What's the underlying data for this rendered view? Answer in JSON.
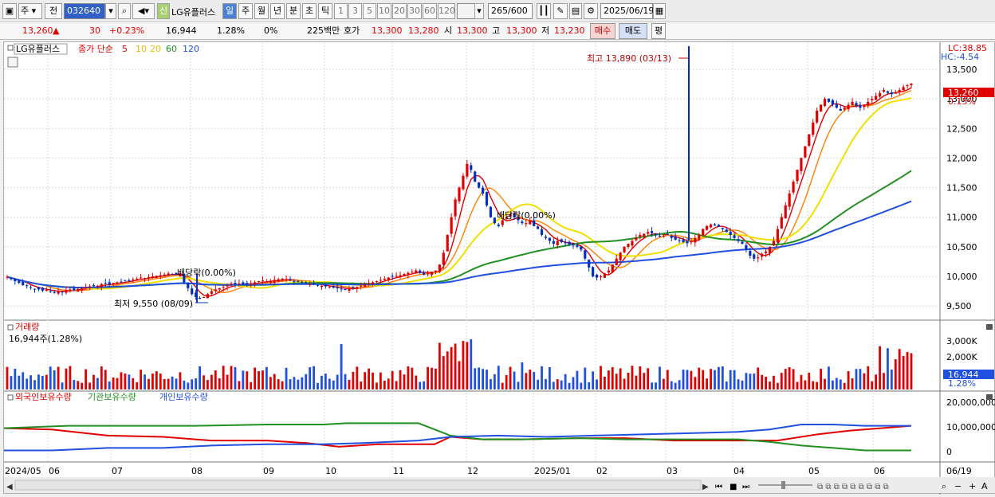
{
  "toolbar": {
    "type_sel": "주",
    "prev_sel": "전",
    "code": "032640",
    "new_badge": "신",
    "name": "LG유플러스",
    "periods": [
      "일",
      "주",
      "월",
      "년",
      "분",
      "초",
      "틱"
    ],
    "active_period": "일",
    "intervals": [
      "1",
      "3",
      "5",
      "10",
      "20",
      "30",
      "60",
      "120"
    ],
    "count": "265",
    "count_max": "/600",
    "date": "2025/06/19"
  },
  "quote": {
    "price": "13,260",
    "arrow": "▲",
    "change": "30",
    "pct": "+0.23%",
    "volume": "16,944",
    "turnover": "1.28%",
    "zero_pct": "0%",
    "amount": "225백만",
    "ask_label": "호가",
    "ask": "13,300",
    "bid": "13,280",
    "open_label": "시",
    "open": "13,300",
    "high_label": "고",
    "high": "13,300",
    "low_label": "저",
    "low": "13,230",
    "buy_btn": "매수",
    "sell_btn": "매도",
    "eval_btn": "평"
  },
  "chart_data": [
    {
      "type": "candlestick",
      "title": "LG유플러스",
      "legend": {
        "main": "종가 단순",
        "ma": [
          {
            "name": "5",
            "color": "#e00000"
          },
          {
            "name": "10",
            "color": "#ff8000"
          },
          {
            "name": "20",
            "color": "#e8e800"
          },
          {
            "name": "60",
            "color": "#209020"
          },
          {
            "name": "120",
            "color": "#2050e0"
          }
        ]
      },
      "y_ticks": [
        "13,500",
        "13,000",
        "12,500",
        "12,000",
        "11,500",
        "11,000",
        "10,500",
        "10,000",
        "9,500"
      ],
      "ylim": [
        9300,
        13850
      ],
      "x_labels": [
        "2024/05",
        "06",
        "07",
        "08",
        "09",
        "10",
        "11",
        "12",
        "2025/01",
        "02",
        "03",
        "04",
        "05",
        "06"
      ],
      "current_price_tag": "13,260",
      "current_pct_tag": "0.15%",
      "lc": "LC:38.85",
      "hc": "HC:-4.54",
      "bottom_date": "06/19",
      "annotations": {
        "high": "최고 13,890 (03/13)",
        "low": "최저 9,550 (08/09)",
        "div1": "배당락(0.00%)",
        "div2": "배당락(0.00%)"
      },
      "close_series": [
        9990,
        9960,
        9920,
        9890,
        9850,
        9840,
        9810,
        9790,
        9780,
        9760,
        9770,
        9750,
        9730,
        9750,
        9740,
        9770,
        9780,
        9760,
        9790,
        9800,
        9810,
        9830,
        9850,
        9840,
        9870,
        9880,
        9860,
        9890,
        9900,
        9910,
        9930,
        9920,
        9950,
        9960,
        9980,
        9970,
        9990,
        10000,
        10010,
        10020,
        10030,
        10050,
        10040,
        10030,
        10050,
        9900,
        9800,
        9700,
        9650,
        9620,
        9650,
        9700,
        9750,
        9780,
        9800,
        9820,
        9850,
        9880,
        9870,
        9880,
        9860,
        9870,
        9880,
        9900,
        9920,
        9930,
        9910,
        9920,
        9940,
        9950,
        9960,
        9950,
        9930,
        9920,
        9910,
        9900,
        9880,
        9870,
        9860,
        9850,
        9840,
        9830,
        9820,
        9810,
        9800,
        9790,
        9780,
        9790,
        9800,
        9820,
        9840,
        9860,
        9880,
        9900,
        9920,
        9940,
        9960,
        9980,
        10000,
        10010,
        10020,
        10040,
        10060,
        10080,
        10100,
        10060,
        10030,
        10050,
        10080,
        10100,
        10200,
        10400,
        10700,
        11000,
        11300,
        11500,
        11700,
        11900,
        11800,
        11600,
        11500,
        11400,
        11200,
        11000,
        10900,
        10850,
        10950,
        11000,
        11050,
        11000,
        10950,
        10900,
        10900,
        10950,
        10850,
        10800,
        10700,
        10650,
        10600,
        10550,
        10600,
        10580,
        10560,
        10540,
        10520,
        10500,
        10450,
        10300,
        10150,
        10000,
        9980,
        10000,
        10050,
        10100,
        10200,
        10300,
        10400,
        10500,
        10550,
        10600,
        10650,
        10700,
        10720,
        10750,
        10730,
        10700,
        10680,
        10690,
        10700,
        10650,
        10620,
        10600,
        10580,
        10560,
        10600,
        10650,
        10700,
        10800,
        10850,
        10880,
        10860,
        10840,
        10800,
        10750,
        10700,
        10650,
        10600,
        10550,
        10450,
        10350,
        10300,
        10320,
        10380,
        10420,
        10500,
        10600,
        10800,
        11000,
        11200,
        11400,
        11600,
        11800,
        12000,
        12200,
        12400,
        12600,
        12800,
        12900,
        13000,
        12950,
        12900,
        12850,
        12800,
        12850,
        12900,
        12950,
        12880,
        12850,
        12900,
        12950,
        13000,
        13050,
        13100,
        13150,
        13100,
        13080,
        13100,
        13150,
        13200,
        13230,
        13260
      ],
      "volume_ticks": [
        "3,000K",
        "2,000K"
      ],
      "volume_label": "거래량",
      "volume_value": "16,944주(1.28%)",
      "volume_tag": "16,944",
      "volume_pct_tag": "1.28%"
    },
    {
      "type": "line",
      "series": [
        {
          "name": "외국인보유수량",
          "color": "#e00000"
        },
        {
          "name": "기관보유수량",
          "color": "#209020"
        },
        {
          "name": "개인보유수량",
          "color": "#2050e0"
        }
      ],
      "y_ticks": [
        "20,000,000",
        "10,000,000",
        "0"
      ]
    }
  ]
}
